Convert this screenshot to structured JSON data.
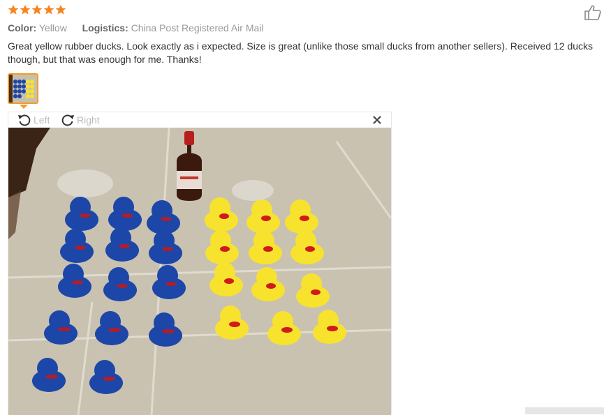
{
  "rating": {
    "stars": 5,
    "max": 5,
    "color": "#f7841e"
  },
  "icons": {
    "star": "star-icon",
    "helpful": "thumbs-up-icon",
    "rotate_left": "rotate-left-icon",
    "rotate_right": "rotate-right-icon",
    "close": "close-icon"
  },
  "meta": {
    "color_label": "Color:",
    "color_value": "Yellow",
    "logistics_label": "Logistics:",
    "logistics_value": "China Post Registered Air Mail"
  },
  "review": {
    "text": "Great yellow rubber ducks. Look exactly as i expected. Size is great (unlike those small ducks from another sellers). Received 12 ducks though, but that was enough for me. Thanks!"
  },
  "viewer": {
    "rotate_left_label": "Left",
    "rotate_right_label": "Right",
    "close_label": "×"
  },
  "colors": {
    "accent": "#f39c2a",
    "blue_duck": "#1c46a8",
    "yellow_duck": "#f7e22e",
    "beak": "#d11a1a"
  }
}
